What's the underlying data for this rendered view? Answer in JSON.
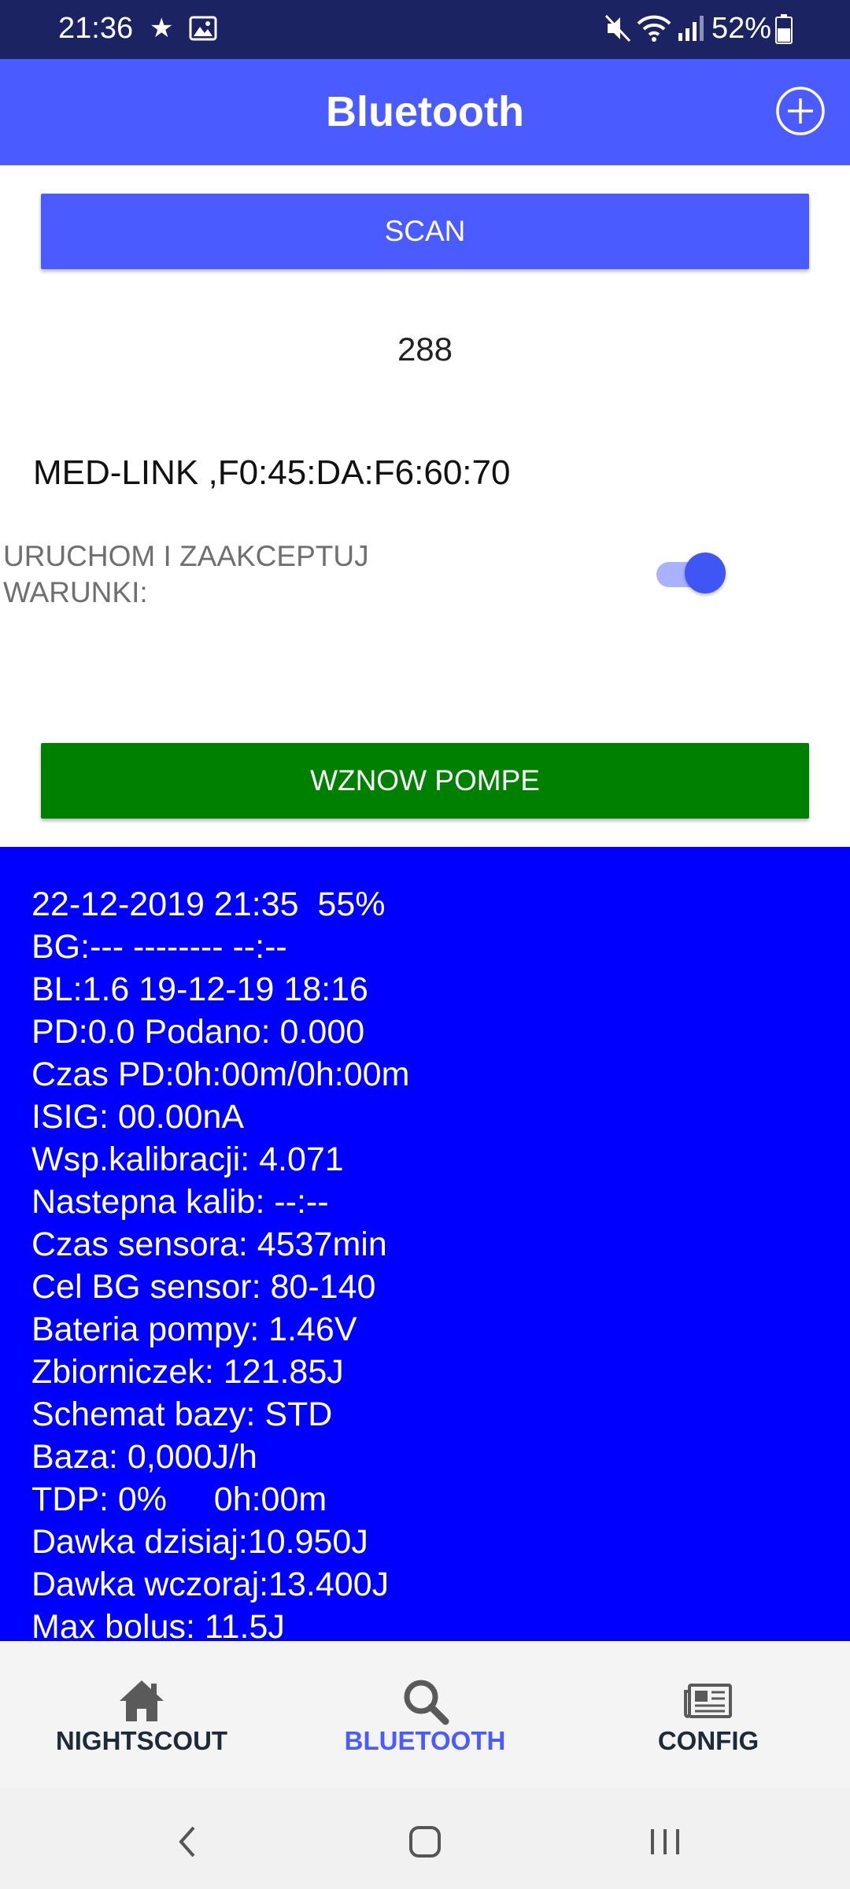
{
  "status_bar": {
    "time": "21:36",
    "battery_text": "52%",
    "icons": [
      "star-icon",
      "image-icon",
      "mute-icon",
      "wifi-icon",
      "signal-icon",
      "battery-icon"
    ]
  },
  "app_bar": {
    "title": "Bluetooth",
    "action_icon": "add-circle-icon"
  },
  "controls": {
    "scan_label": "SCAN",
    "count": "288",
    "device": "MED-LINK ,F0:45:DA:F6:60:70",
    "accept_label": "URUCHOM I ZAAKCEPTUJ WARUNKI:",
    "accept_toggle_on": true,
    "resume_label": "WZNOW POMPE"
  },
  "info": {
    "lines": [
      "22-12-2019 21:35  55%",
      "BG:--- -------- --:--",
      "BL:1.6 19-12-19 18:16",
      "PD:0.0 Podano: 0.000",
      "Czas PD:0h:00m/0h:00m",
      "ISIG: 00.00nA",
      "Wsp.kalibracji: 4.071",
      "Nastepna kalib: --:--",
      "Czas sensora: 4537min",
      "Cel BG sensor: 80-140",
      "Bateria pompy: 1.46V",
      "Zbiorniczek: 121.85J",
      "Schemat bazy: STD",
      "Baza: 0,000J/h",
      "TDP: 0%     0h:00m",
      "Dawka dzisiaj:10.950J",
      "Dawka wczoraj:13.400J",
      "Max bolus: 11.5J"
    ]
  },
  "bottom_nav": {
    "items": [
      {
        "label": "NIGHTSCOUT",
        "icon": "home-icon",
        "active": false
      },
      {
        "label": "BLUETOOTH",
        "icon": "search-icon",
        "active": true
      },
      {
        "label": "CONFIG",
        "icon": "newspaper-icon",
        "active": false
      }
    ]
  },
  "system_nav": {
    "icons": [
      "back-icon",
      "home-button-icon",
      "recents-icon"
    ]
  },
  "colors": {
    "status_bar": "#1b2363",
    "primary": "#4a5cff",
    "resume_button": "#008000",
    "info_panel": "#0000ff"
  }
}
